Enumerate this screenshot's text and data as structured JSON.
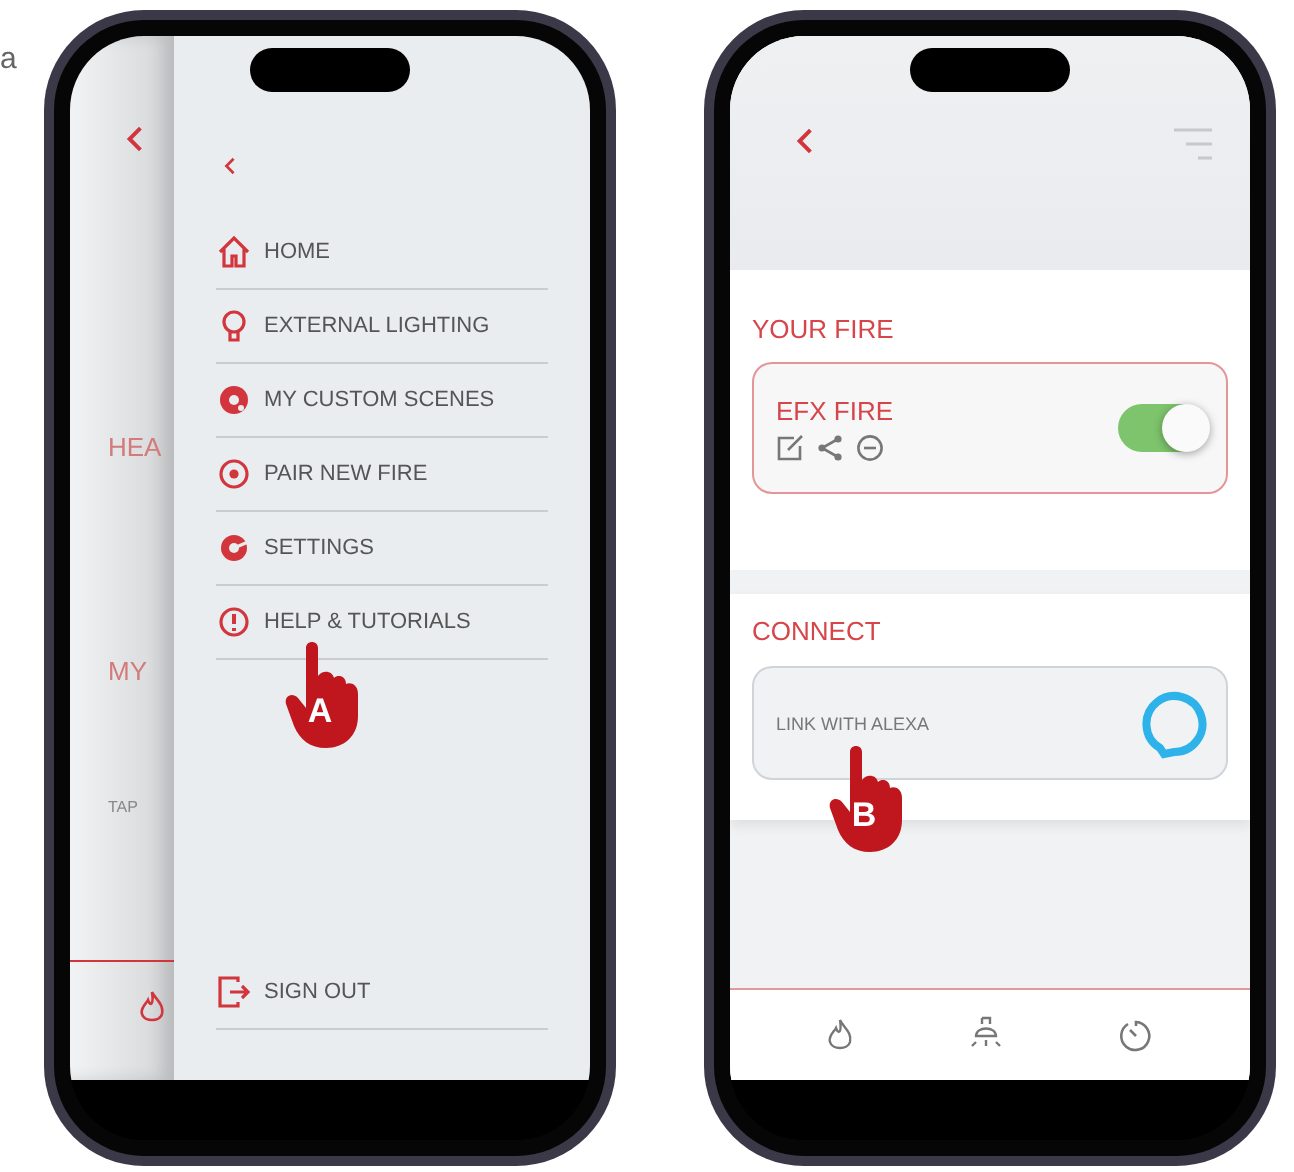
{
  "caption_fragment": "a",
  "menu_phone": {
    "background_screen": {
      "texts": [
        "HEA",
        "MY",
        "TAP"
      ]
    },
    "menu": {
      "items": [
        {
          "label": "HOME"
        },
        {
          "label": "EXTERNAL LIGHTING"
        },
        {
          "label": "MY CUSTOM SCENES"
        },
        {
          "label": "PAIR NEW FIRE"
        },
        {
          "label": "SETTINGS"
        },
        {
          "label": "HELP & TUTORIALS"
        }
      ],
      "sign_out": "SIGN OUT"
    },
    "pointer": {
      "label": "A"
    }
  },
  "fire_phone": {
    "your_fire": {
      "title": "YOUR FIRE",
      "device": {
        "name": "EFX FIRE",
        "on": true
      }
    },
    "connect": {
      "title": "CONNECT",
      "link": "LINK WITH ALEXA"
    },
    "pointer": {
      "label": "B"
    }
  }
}
